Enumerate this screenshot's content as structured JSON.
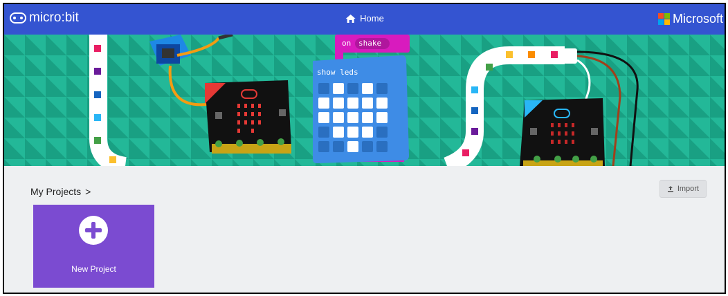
{
  "topbar": {
    "brand": "micro:bit",
    "home_label": "Home",
    "vendor": "Microsoft"
  },
  "hero": {
    "block_event": "on",
    "block_event_arg": "shake",
    "block_show": "show leds"
  },
  "projects": {
    "heading": "My Projects",
    "chevron": ">",
    "import_label": "Import",
    "new_project_label": "New Project"
  },
  "colors": {
    "topbar": "#3454d1",
    "hero": "#1fae90",
    "card": "#7b4bd1",
    "block_pink": "#d81bbe",
    "block_blue": "#3e8ce6"
  }
}
